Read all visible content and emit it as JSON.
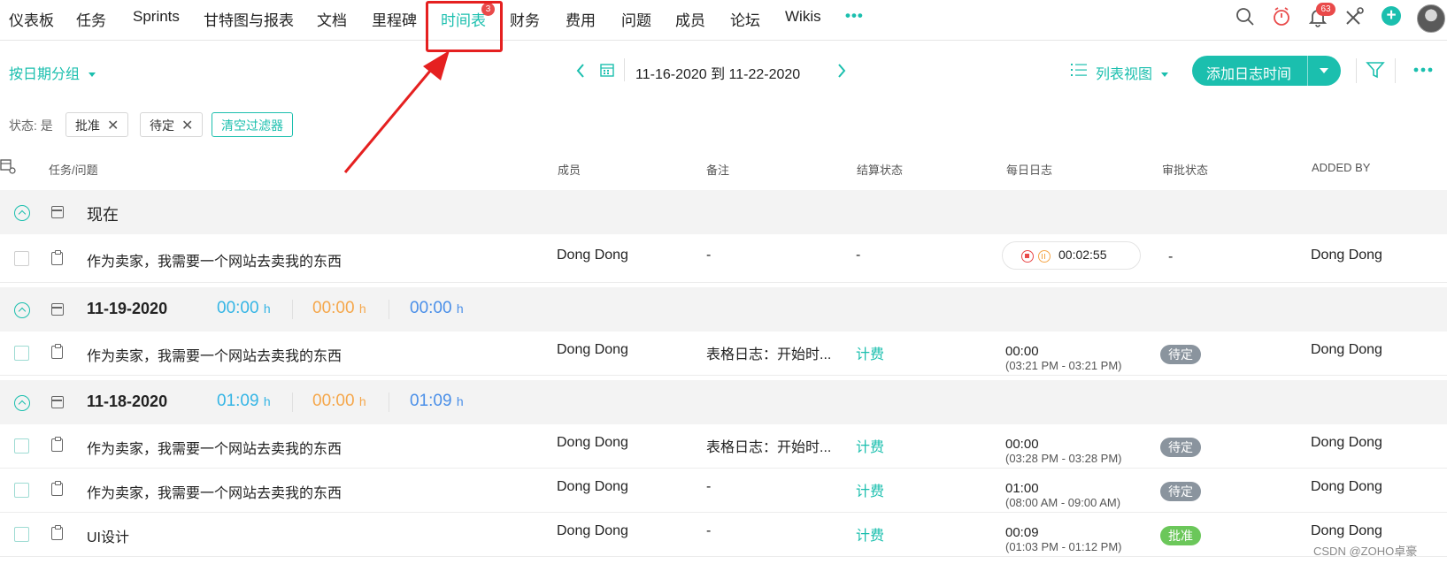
{
  "nav": {
    "items": [
      "仪表板",
      "任务",
      "Sprints",
      "甘特图与报表",
      "文档",
      "里程碑",
      "时间表",
      "财务",
      "费用",
      "问题",
      "成员",
      "论坛",
      "Wikis"
    ],
    "active": "时间表",
    "active_badge": "3",
    "more": "•••",
    "notification_count": "63"
  },
  "toolbar": {
    "group_by": "按日期分组",
    "date_range": "11-16-2020 到 11-22-2020",
    "view_mode": "列表视图",
    "add_button": "添加日志时间"
  },
  "filters": {
    "label": "状态: 是",
    "chips": [
      "批准",
      "待定"
    ],
    "clear": "清空过滤器"
  },
  "columns": {
    "task": "任务/问题",
    "member": "成员",
    "notes": "备注",
    "billing": "结算状态",
    "daily_log": "每日日志",
    "approval": "审批状态",
    "added_by": "ADDED BY"
  },
  "groups": [
    {
      "title": "现在",
      "rows": [
        {
          "task": "作为卖家，我需要一个网站去卖我的东西",
          "member": "Dong Dong",
          "notes": "-",
          "billing": "-",
          "timer": "00:02:55",
          "approval": "-",
          "added_by": "Dong Dong"
        }
      ]
    },
    {
      "title": "11-19-2020",
      "totals": [
        {
          "v": "00:00",
          "u": "h"
        },
        {
          "v": "00:00",
          "u": "h"
        },
        {
          "v": "00:00",
          "u": "h"
        }
      ],
      "rows": [
        {
          "task": "作为卖家，我需要一个网站去卖我的东西",
          "member": "Dong Dong",
          "notes": "表格日志：开始时...",
          "billing": "计费",
          "log": "00:00",
          "range": "(03:21 PM - 03:21 PM)",
          "approval": "待定",
          "added_by": "Dong Dong"
        }
      ]
    },
    {
      "title": "11-18-2020",
      "totals": [
        {
          "v": "01:09",
          "u": "h"
        },
        {
          "v": "00:00",
          "u": "h"
        },
        {
          "v": "01:09",
          "u": "h"
        }
      ],
      "rows": [
        {
          "task": "作为卖家，我需要一个网站去卖我的东西",
          "member": "Dong Dong",
          "notes": "表格日志：开始时...",
          "billing": "计费",
          "log": "00:00",
          "range": "(03:28 PM - 03:28 PM)",
          "approval": "待定",
          "added_by": "Dong Dong"
        },
        {
          "task": "作为卖家，我需要一个网站去卖我的东西",
          "member": "Dong Dong",
          "notes": "-",
          "billing": "计费",
          "log": "01:00",
          "range": "(08:00 AM - 09:00 AM)",
          "approval": "待定",
          "added_by": "Dong Dong"
        },
        {
          "task": "UI设计",
          "member": "Dong Dong",
          "notes": "-",
          "billing": "计费",
          "log": "00:09",
          "range": "(01:03 PM - 01:12 PM)",
          "approval": "批准",
          "added_by": "Dong Dong"
        }
      ]
    }
  ],
  "colors": {
    "accent": "#1bbfae",
    "highlight": "#e52020",
    "pending": "#8a949e",
    "approved": "#6bc75a"
  },
  "watermark": "CSDN @ZOHO卓豪"
}
